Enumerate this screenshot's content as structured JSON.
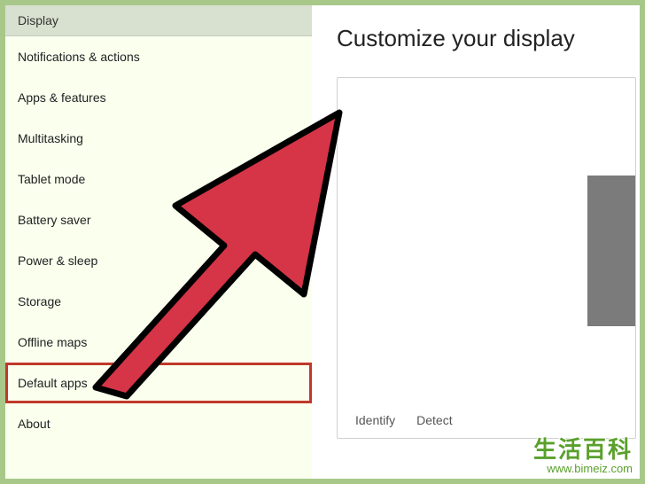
{
  "sidebar": {
    "header": "Display",
    "items": [
      {
        "label": "Notifications & actions"
      },
      {
        "label": "Apps & features"
      },
      {
        "label": "Multitasking"
      },
      {
        "label": "Tablet mode"
      },
      {
        "label": "Battery saver"
      },
      {
        "label": "Power & sleep"
      },
      {
        "label": "Storage"
      },
      {
        "label": "Offline maps"
      },
      {
        "label": "Default apps",
        "highlighted": true
      },
      {
        "label": "About"
      }
    ]
  },
  "main": {
    "title": "Customize your display",
    "actions": {
      "identify": "Identify",
      "detect": "Detect"
    }
  },
  "watermark": {
    "cn": "生活百科",
    "url": "www.bimeiz.com"
  },
  "annotation": {
    "arrow_color": "#d63447",
    "arrow_stroke": "#000000"
  }
}
